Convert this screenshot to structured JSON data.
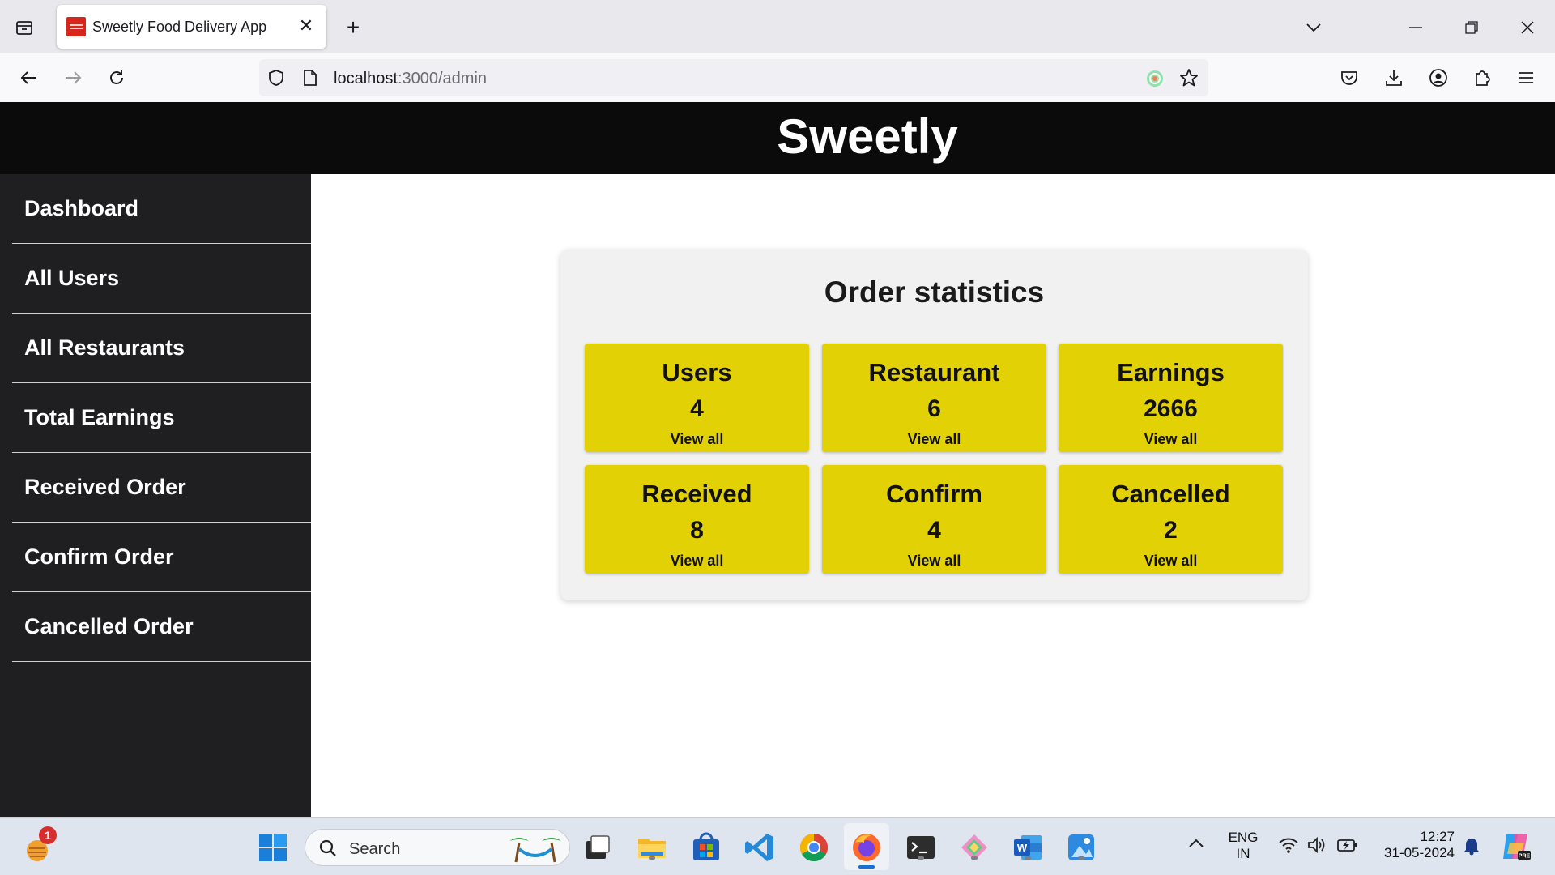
{
  "browser": {
    "tab_title": "Sweetly Food Delivery App",
    "url_host": "localhost",
    "url_rest": ":3000/admin"
  },
  "app": {
    "title": "Sweetly"
  },
  "sidebar": {
    "items": [
      {
        "label": "Dashboard"
      },
      {
        "label": "All Users"
      },
      {
        "label": "All Restaurants"
      },
      {
        "label": "Total Earnings"
      },
      {
        "label": "Received Order"
      },
      {
        "label": "Confirm Order"
      },
      {
        "label": "Cancelled Order"
      }
    ]
  },
  "stats": {
    "title": "Order statistics",
    "cards": [
      {
        "label": "Users",
        "value": "4",
        "link": "View all"
      },
      {
        "label": "Restaurant",
        "value": "6",
        "link": "View all"
      },
      {
        "label": "Earnings",
        "value": "2666",
        "link": "View all"
      },
      {
        "label": "Received",
        "value": "8",
        "link": "View all"
      },
      {
        "label": "Confirm",
        "value": "4",
        "link": "View all"
      },
      {
        "label": "Cancelled",
        "value": "2",
        "link": "View all"
      }
    ]
  },
  "taskbar": {
    "search_placeholder": "Search",
    "notification_badge": "1",
    "lang_line1": "ENG",
    "lang_line2": "IN",
    "time": "12:27",
    "date": "31-05-2024"
  },
  "colors": {
    "header_bg": "#0b0b0b",
    "sidebar_bg": "#1f1e21",
    "stat_card_bg": "#e2d104",
    "stats_panel_bg": "#f1f1f1"
  }
}
